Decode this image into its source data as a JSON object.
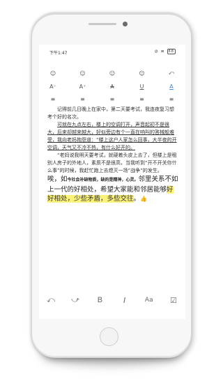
{
  "status_bar": {
    "time": "下午1:47",
    "signal_wifi": "⊘ ≋ ",
    "battery": "68"
  },
  "toolbar": {
    "row1": [
      {
        "name": "emoji-1-icon",
        "glyph": "☺"
      },
      {
        "name": "emoji-2-icon",
        "glyph": "☺"
      },
      {
        "name": "emoji-3-icon",
        "glyph": "☺"
      },
      {
        "name": "emoji-4-icon",
        "glyph": "☺"
      },
      {
        "name": "undo-icon",
        "glyph": "⤺"
      }
    ],
    "row2": [
      {
        "name": "font-decrease-icon",
        "glyph": "A⁻"
      },
      {
        "name": "font-increase-icon",
        "glyph": "A⁺"
      },
      {
        "name": "strikethrough-icon",
        "glyph": "A"
      },
      {
        "name": "underline-icon",
        "glyph": "U"
      },
      {
        "name": "text-color-icon",
        "glyph": "A"
      }
    ],
    "row3": [
      {
        "name": "align-left-icon",
        "glyph": "≡"
      },
      {
        "name": "align-center-icon",
        "glyph": "≡"
      },
      {
        "name": "align-right-icon",
        "glyph": "≡"
      },
      {
        "name": "align-justify-icon",
        "glyph": "≡"
      },
      {
        "name": "align-distribute-icon",
        "glyph": "≡"
      }
    ]
  },
  "content": {
    "p1": "记得前几日晚上在家中，第二天要考试，我连夜复习想考个好的名次。",
    "p2": "可就在九点左右，楼上的空调打开，声音起初不是很大，后来却越来越大，好似旁边有个一直在响叫的答械般难受，我向老妈抱怨道：“楼上这户人家怎么回事，大半夜的开空调，天气又不冷不热，有什么好开的。",
    "p3": "“老妈说我明天要考试，就硬着头皮上去了，但楼上是租别人房子的外地人，素质不是很高，当我听到“开不开关你什么事”的时候，我赶忙跑上去熄灭一场“战争”的发生。",
    "p4_a": "唉，如",
    "p4_small": "今社会补缺物质，缺的是精神，心灵。",
    "p4_b": "邻里关系不如上一代的好相处，希望大家能和邻居能够",
    "p4_highlight": "好好相处，少些矛盾，多些交往",
    "p4_end": "。",
    "emoji": "👍"
  },
  "bottom_bar": [
    {
      "name": "undo-bottom-icon",
      "glyph": "⤺"
    },
    {
      "name": "redo-bottom-icon",
      "glyph": "⤻"
    },
    {
      "name": "bold-icon",
      "glyph": "B"
    },
    {
      "name": "italic-icon",
      "glyph": "I"
    },
    {
      "name": "font-size-icon",
      "glyph": "Aa"
    },
    {
      "name": "checkbox-icon",
      "glyph": "☑"
    }
  ],
  "colors": {
    "accent": "#3a86d8",
    "highlight": "#fbf27a"
  }
}
